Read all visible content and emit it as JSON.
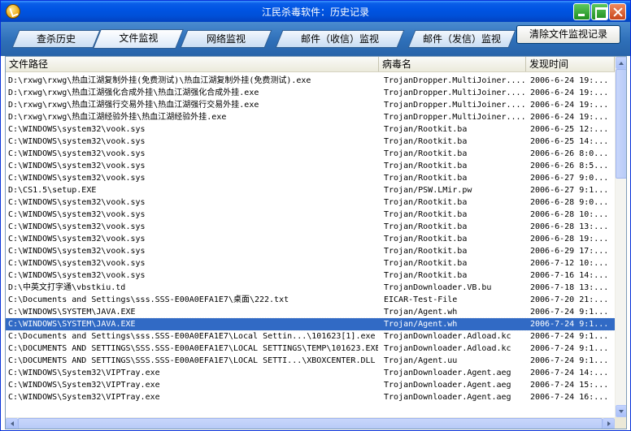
{
  "window": {
    "title": "江民杀毒软件：历史记录"
  },
  "tabs": [
    {
      "label": "查杀历史",
      "active": false
    },
    {
      "label": "文件监视",
      "active": true
    },
    {
      "label": "网络监视",
      "active": false
    },
    {
      "label": "邮件（收信）监视",
      "active": false
    },
    {
      "label": "邮件（发信）监视",
      "active": false
    }
  ],
  "toolbar": {
    "clear_label": "清除文件监视记录"
  },
  "table": {
    "columns": [
      "文件路径",
      "病毒名",
      "发现时间"
    ],
    "selected_index": 20,
    "rows": [
      [
        "D:\\rxwg\\rxwg\\热血江湖复制外挂(免费测试)\\热血江湖复制外挂(免费测试).exe",
        "TrojanDropper.MultiJoiner....",
        "2006-6-24 19:..."
      ],
      [
        "D:\\rxwg\\rxwg\\热血江湖强化合成外挂\\热血江湖强化合成外挂.exe",
        "TrojanDropper.MultiJoiner....",
        "2006-6-24 19:..."
      ],
      [
        "D:\\rxwg\\rxwg\\热血江湖强行交易外挂\\热血江湖强行交易外挂.exe",
        "TrojanDropper.MultiJoiner....",
        "2006-6-24 19:..."
      ],
      [
        "D:\\rxwg\\rxwg\\热血江湖经验外挂\\热血江湖经验外挂.exe",
        "TrojanDropper.MultiJoiner....",
        "2006-6-24 19:..."
      ],
      [
        "C:\\WINDOWS\\system32\\vook.sys",
        "Trojan/Rootkit.ba",
        "2006-6-25 12:..."
      ],
      [
        "C:\\WINDOWS\\system32\\vook.sys",
        "Trojan/Rootkit.ba",
        "2006-6-25 14:..."
      ],
      [
        "C:\\WINDOWS\\system32\\vook.sys",
        "Trojan/Rootkit.ba",
        "2006-6-26 8:0..."
      ],
      [
        "C:\\WINDOWS\\system32\\vook.sys",
        "Trojan/Rootkit.ba",
        "2006-6-26 8:5..."
      ],
      [
        "C:\\WINDOWS\\system32\\vook.sys",
        "Trojan/Rootkit.ba",
        "2006-6-27 9:0..."
      ],
      [
        "D:\\CS1.5\\setup.EXE",
        "Trojan/PSW.LMir.pw",
        "2006-6-27 9:1..."
      ],
      [
        "C:\\WINDOWS\\system32\\vook.sys",
        "Trojan/Rootkit.ba",
        "2006-6-28 9:0..."
      ],
      [
        "C:\\WINDOWS\\system32\\vook.sys",
        "Trojan/Rootkit.ba",
        "2006-6-28 10:..."
      ],
      [
        "C:\\WINDOWS\\system32\\vook.sys",
        "Trojan/Rootkit.ba",
        "2006-6-28 13:..."
      ],
      [
        "C:\\WINDOWS\\system32\\vook.sys",
        "Trojan/Rootkit.ba",
        "2006-6-28 19:..."
      ],
      [
        "C:\\WINDOWS\\system32\\vook.sys",
        "Trojan/Rootkit.ba",
        "2006-6-29 17:..."
      ],
      [
        "C:\\WINDOWS\\system32\\vook.sys",
        "Trojan/Rootkit.ba",
        "2006-7-12 10:..."
      ],
      [
        "C:\\WINDOWS\\system32\\vook.sys",
        "Trojan/Rootkit.ba",
        "2006-7-16 14:..."
      ],
      [
        "D:\\中英文打字通\\vbstkiu.td",
        "TrojanDownloader.VB.bu",
        "2006-7-18 13:..."
      ],
      [
        "C:\\Documents and Settings\\sss.SSS-E00A0EFA1E7\\桌面\\222.txt",
        "EICAR-Test-File",
        "2006-7-20 21:..."
      ],
      [
        "C:\\WINDOWS\\SYSTEM\\JAVA.EXE",
        "Trojan/Agent.wh",
        "2006-7-24 9:1..."
      ],
      [
        "C:\\WINDOWS\\SYSTEM\\JAVA.EXE",
        "Trojan/Agent.wh",
        "2006-7-24 9:1..."
      ],
      [
        "C:\\Documents and Settings\\sss.SSS-E00A0EFA1E7\\Local Settin...\\101623[1].exe",
        "TrojanDownloader.Adload.kc",
        "2006-7-24 9:1..."
      ],
      [
        "C:\\DOCUMENTS AND SETTINGS\\SSS.SSS-E00A0EFA1E7\\LOCAL SETTINGS\\TEMP\\101623.EXE",
        "TrojanDownloader.Adload.kc",
        "2006-7-24 9:1..."
      ],
      [
        "C:\\DOCUMENTS AND SETTINGS\\SSS.SSS-E00A0EFA1E7\\LOCAL SETTI...\\XBOXCENTER.DLL",
        "Trojan/Agent.uu",
        "2006-7-24 9:1..."
      ],
      [
        "C:\\WINDOWS\\System32\\VIPTray.exe",
        "TrojanDownloader.Agent.aeg",
        "2006-7-24 14:..."
      ],
      [
        "C:\\WINDOWS\\System32\\VIPTray.exe",
        "TrojanDownloader.Agent.aeg",
        "2006-7-24 15:..."
      ],
      [
        "C:\\WINDOWS\\System32\\VIPTray.exe",
        "TrojanDownloader.Agent.aeg",
        "2006-7-24 16:..."
      ]
    ]
  }
}
